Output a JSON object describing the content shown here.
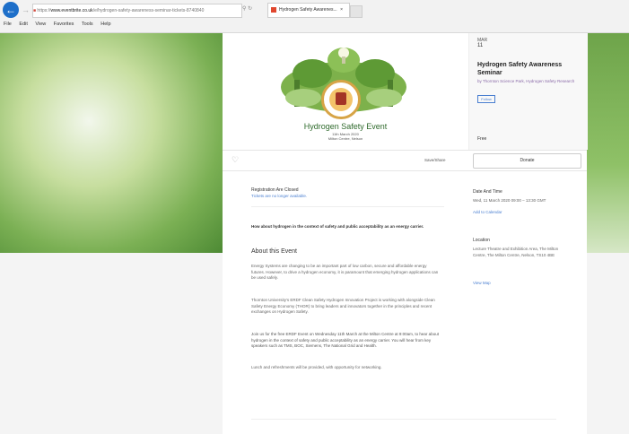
{
  "browser": {
    "address_prefix": "https://",
    "address_host": "www.eventbrite.co.uk",
    "address_path": "/e/hydrogen-safety-awareness-seminar-tickets-8740840",
    "tab_title": "Hydrogen Safety Awarenes...",
    "menu": [
      "File",
      "Edit",
      "View",
      "Favorites",
      "Tools",
      "Help"
    ]
  },
  "banner": {
    "title": "Hydrogen Safety Event",
    "subtitle_line1": "11th March 2020",
    "subtitle_line2": "Milton Centre, Nelson"
  },
  "event": {
    "month": "MAR",
    "day": "11",
    "title": "Hydrogen Safety Awareness Seminar",
    "organizer": "by Thornton Science Park, Hydrogen Safety Research",
    "follow_label": "Follow",
    "price": "Free",
    "share_label": "Save/Share",
    "donate_label": "Donate"
  },
  "registration": {
    "heading": "Registration Are Closed",
    "note": "Tickets are no longer available."
  },
  "summary": "How about hydrogen in the context of safety and public acceptability as an energy carrier.",
  "about": {
    "heading": "About this Event",
    "p1": "Energy Systems are changing to be an important part of low carbon, secure and affordable energy futures. However, to drive a hydrogen economy, it is paramount that emerging hydrogen applications can be used safely.",
    "p2": "Thornton University's ERDF Clean Safety Hydrogen Innovation Project is working with alongside Clean Safety Energy Economy (THOR) to bring leaders and innovators together in the principles and recent exchanges on Hydrogen Safety.",
    "p3": "Join us for the free ERDF Event on Wednesday 11th March at the Milton Centre at 9:00am, to hear about hydrogen in the context of safety and public acceptability as an energy carrier. You will hear from key speakers such as TMS, BOC, Siemens, The National Grid and Health.",
    "p4": "Lunch and refreshments will be provided, with opportunity for networking."
  },
  "datetime": {
    "heading": "Date And Time",
    "value": "Wed, 11 March 2020 09:00 – 13:30 GMT",
    "calendar_link": "Add to Calendar"
  },
  "location": {
    "heading": "Location",
    "value": "Lecture Theatre and Exhibition Area, The Milton Centre, The Milton Centre, Nelson, TS10 4BE",
    "map_link": "View Map"
  }
}
